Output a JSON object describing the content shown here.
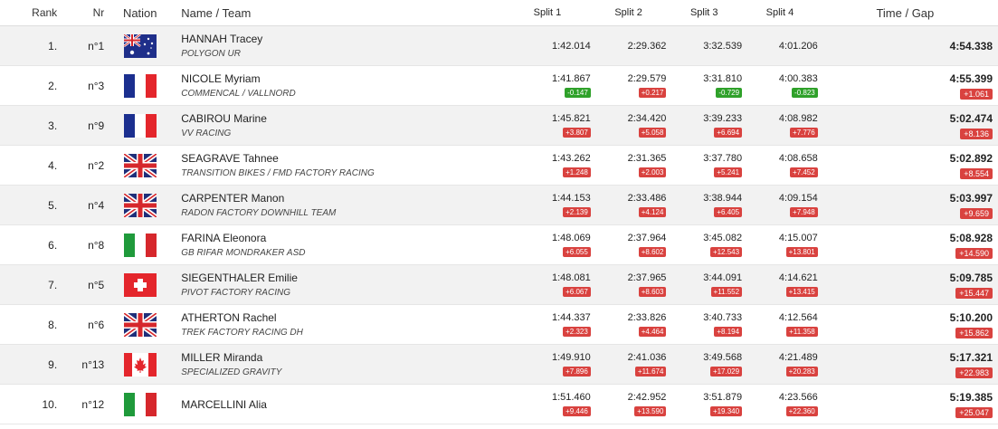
{
  "headers": {
    "rank": "Rank",
    "nr": "Nr",
    "nation": "Nation",
    "name_team": "Name / Team",
    "split1": "Split 1",
    "split2": "Split 2",
    "split3": "Split 3",
    "split4": "Split 4",
    "time_gap": "Time / Gap"
  },
  "colors": {
    "slower_badge": "#d9423f",
    "faster_badge": "#2fa12a",
    "row_alt": "#f2f2f2"
  },
  "rows": [
    {
      "rank": "1.",
      "nr": "n°1",
      "flag": "australia-flag",
      "name": "HANNAH Tracey",
      "team": "POLYGON UR",
      "s1": "1:42.014",
      "s1g": "",
      "s2": "2:29.362",
      "s2g": "",
      "s3": "3:32.539",
      "s3g": "",
      "s4": "4:01.206",
      "s4g": "",
      "time": "4:54.338",
      "gap": ""
    },
    {
      "rank": "2.",
      "nr": "n°3",
      "flag": "france-flag",
      "name": "NICOLE Myriam",
      "team": "COMMENCAL / VALLNORD",
      "s1": "1:41.867",
      "s1g": "-0.147",
      "s2": "2:29.579",
      "s2g": "+0.217",
      "s3": "3:31.810",
      "s3g": "-0.729",
      "s4": "4:00.383",
      "s4g": "-0.823",
      "time": "4:55.399",
      "gap": "+1.061"
    },
    {
      "rank": "3.",
      "nr": "n°9",
      "flag": "france-flag",
      "name": "CABIROU Marine",
      "team": "VV RACING",
      "s1": "1:45.821",
      "s1g": "+3.807",
      "s2": "2:34.420",
      "s2g": "+5.058",
      "s3": "3:39.233",
      "s3g": "+6.694",
      "s4": "4:08.982",
      "s4g": "+7.776",
      "time": "5:02.474",
      "gap": "+8.136"
    },
    {
      "rank": "4.",
      "nr": "n°2",
      "flag": "uk-flag",
      "name": "SEAGRAVE Tahnee",
      "team": "TRANSITION BIKES / FMD FACTORY RACING",
      "s1": "1:43.262",
      "s1g": "+1.248",
      "s2": "2:31.365",
      "s2g": "+2.003",
      "s3": "3:37.780",
      "s3g": "+5.241",
      "s4": "4:08.658",
      "s4g": "+7.452",
      "time": "5:02.892",
      "gap": "+8.554"
    },
    {
      "rank": "5.",
      "nr": "n°4",
      "flag": "uk-flag",
      "name": "CARPENTER Manon",
      "team": "RADON FACTORY DOWNHILL TEAM",
      "s1": "1:44.153",
      "s1g": "+2.139",
      "s2": "2:33.486",
      "s2g": "+4.124",
      "s3": "3:38.944",
      "s3g": "+6.405",
      "s4": "4:09.154",
      "s4g": "+7.948",
      "time": "5:03.997",
      "gap": "+9.659"
    },
    {
      "rank": "6.",
      "nr": "n°8",
      "flag": "italy-flag",
      "name": "FARINA Eleonora",
      "team": "GB RIFAR MONDRAKER ASD",
      "s1": "1:48.069",
      "s1g": "+6.055",
      "s2": "2:37.964",
      "s2g": "+8.602",
      "s3": "3:45.082",
      "s3g": "+12.543",
      "s4": "4:15.007",
      "s4g": "+13.801",
      "time": "5:08.928",
      "gap": "+14.590"
    },
    {
      "rank": "7.",
      "nr": "n°5",
      "flag": "switzerland-flag",
      "name": "SIEGENTHALER Emilie",
      "team": "PIVOT FACTORY RACING",
      "s1": "1:48.081",
      "s1g": "+6.067",
      "s2": "2:37.965",
      "s2g": "+8.603",
      "s3": "3:44.091",
      "s3g": "+11.552",
      "s4": "4:14.621",
      "s4g": "+13.415",
      "time": "5:09.785",
      "gap": "+15.447"
    },
    {
      "rank": "8.",
      "nr": "n°6",
      "flag": "uk-flag",
      "name": "ATHERTON Rachel",
      "team": "TREK FACTORY RACING DH",
      "s1": "1:44.337",
      "s1g": "+2.323",
      "s2": "2:33.826",
      "s2g": "+4.464",
      "s3": "3:40.733",
      "s3g": "+8.194",
      "s4": "4:12.564",
      "s4g": "+11.358",
      "time": "5:10.200",
      "gap": "+15.862"
    },
    {
      "rank": "9.",
      "nr": "n°13",
      "flag": "canada-flag",
      "name": "MILLER Miranda",
      "team": "SPECIALIZED GRAVITY",
      "s1": "1:49.910",
      "s1g": "+7.896",
      "s2": "2:41.036",
      "s2g": "+11.674",
      "s3": "3:49.568",
      "s3g": "+17.029",
      "s4": "4:21.489",
      "s4g": "+20.283",
      "time": "5:17.321",
      "gap": "+22.983"
    },
    {
      "rank": "10.",
      "nr": "n°12",
      "flag": "italy-flag",
      "name": "MARCELLINI Alia",
      "team": "",
      "s1": "1:51.460",
      "s1g": "+9.446",
      "s2": "2:42.952",
      "s2g": "+13.590",
      "s3": "3:51.879",
      "s3g": "+19.340",
      "s4": "4:23.566",
      "s4g": "+22.360",
      "time": "5:19.385",
      "gap": "+25.047"
    }
  ]
}
